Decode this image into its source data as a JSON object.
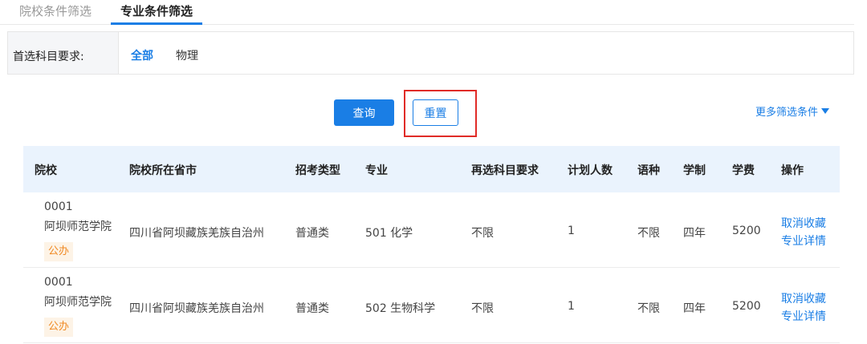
{
  "tabs": {
    "school_filter": "院校条件筛选",
    "major_filter": "专业条件筛选"
  },
  "filter": {
    "label": "首选科目要求:",
    "options": [
      "全部",
      "物理"
    ],
    "selected": "全部"
  },
  "actions": {
    "query": "查询",
    "reset": "重置",
    "more_filters": "更多筛选条件"
  },
  "table": {
    "headers": [
      "院校",
      "院校所在省市",
      "招考类型",
      "专业",
      "再选科目要求",
      "计划人数",
      "语种",
      "学制",
      "学费",
      "操作"
    ],
    "rows": [
      {
        "code": "0001",
        "school": "阿坝师范学院",
        "badge": "公办",
        "province": "四川省阿坝藏族羌族自治州",
        "type": "普通类",
        "major": "501 化学",
        "requirement": "不限",
        "plan": "1",
        "language": "不限",
        "duration": "四年",
        "fee": "5200",
        "op_unfavorite": "取消收藏",
        "op_detail": "专业详情"
      },
      {
        "code": "0001",
        "school": "阿坝师范学院",
        "badge": "公办",
        "province": "四川省阿坝藏族羌族自治州",
        "type": "普通类",
        "major": "502 生物科学",
        "requirement": "不限",
        "plan": "1",
        "language": "不限",
        "duration": "四年",
        "fee": "5200",
        "op_unfavorite": "取消收藏",
        "op_detail": "专业详情"
      }
    ]
  },
  "colors": {
    "accent": "#1a7ee5",
    "highlight_border": "#e02b27",
    "badge_text": "#f08a24",
    "header_bg": "#eaf3fd"
  }
}
